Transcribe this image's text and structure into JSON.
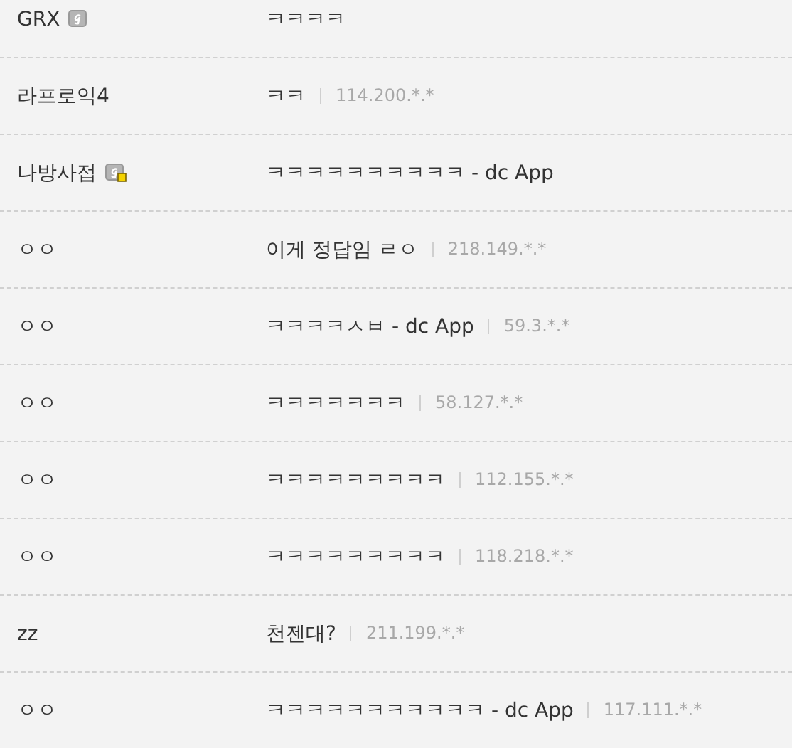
{
  "comments": [
    {
      "name": "GRX",
      "nick_icon": true,
      "fixed": false,
      "text": "ㅋㅋㅋㅋ"
    },
    {
      "name": "라프로익4",
      "text": "ㅋㅋ",
      "ip": "114.200.*.*"
    },
    {
      "name": "나방사접",
      "nick_icon": true,
      "fixed": true,
      "text": "ㅋㅋㅋㅋㅋㅋㅋㅋㅋㅋ - dc App"
    },
    {
      "name": "ㅇㅇ",
      "text": "이게 정답임 ㄹㅇ",
      "ip": "218.149.*.*"
    },
    {
      "name": "ㅇㅇ",
      "text": "ㅋㅋㅋㅋㅅㅂ - dc App",
      "ip": "59.3.*.*"
    },
    {
      "name": "ㅇㅇ",
      "text": "ㅋㅋㅋㅋㅋㅋㅋ",
      "ip": "58.127.*.*"
    },
    {
      "name": "ㅇㅇ",
      "text": "ㅋㅋㅋㅋㅋㅋㅋㅋㅋ",
      "ip": "112.155.*.*"
    },
    {
      "name": "ㅇㅇ",
      "text": "ㅋㅋㅋㅋㅋㅋㅋㅋㅋ",
      "ip": "118.218.*.*"
    },
    {
      "name": "zz",
      "text": "천젠대?",
      "ip": "211.199.*.*"
    },
    {
      "name": "ㅇㅇ",
      "text": "ㅋㅋㅋㅋㅋㅋㅋㅋㅋㅋㅋ - dc App",
      "ip": "117.111.*.*"
    }
  ]
}
